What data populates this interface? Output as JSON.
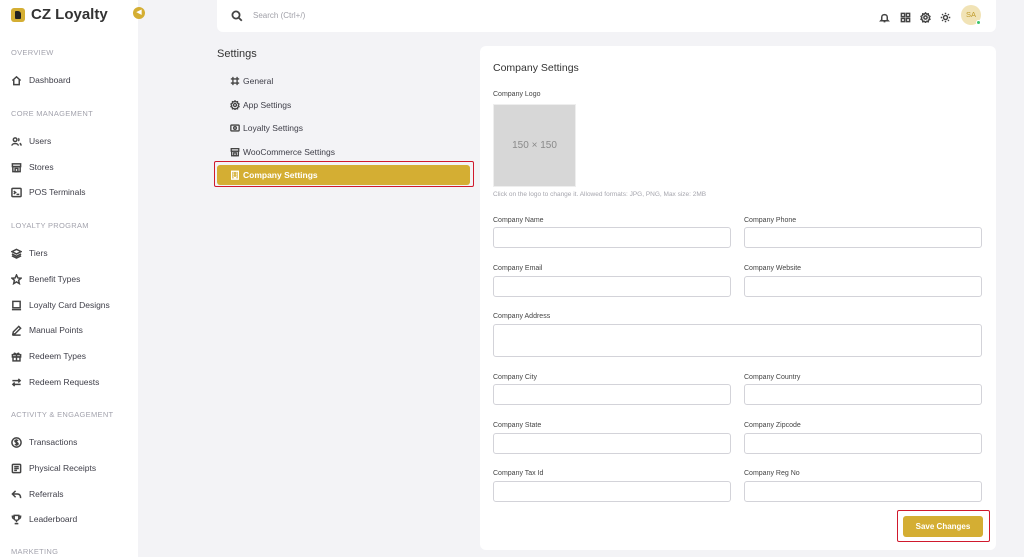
{
  "brand": {
    "name": "CZ Loyalty",
    "accent": "#d4ae33"
  },
  "sidebar": {
    "sections": [
      {
        "label": "OVERVIEW"
      },
      {
        "label": "CORE MANAGEMENT"
      },
      {
        "label": "LOYALTY PROGRAM"
      },
      {
        "label": "ACTIVITY & ENGAGEMENT"
      },
      {
        "label": "MARKETING"
      }
    ],
    "items": [
      {
        "label": "Dashboard",
        "icon": "home-icon"
      },
      {
        "label": "Users",
        "icon": "users-icon"
      },
      {
        "label": "Stores",
        "icon": "store-icon"
      },
      {
        "label": "POS Terminals",
        "icon": "terminal-icon"
      },
      {
        "label": "Tiers",
        "icon": "layers-icon"
      },
      {
        "label": "Benefit Types",
        "icon": "star-icon"
      },
      {
        "label": "Loyalty Card Designs",
        "icon": "card-icon"
      },
      {
        "label": "Manual Points",
        "icon": "pencil-icon"
      },
      {
        "label": "Redeem Types",
        "icon": "gift-icon"
      },
      {
        "label": "Redeem Requests",
        "icon": "arrows-icon"
      },
      {
        "label": "Transactions",
        "icon": "dollar-icon"
      },
      {
        "label": "Physical Receipts",
        "icon": "receipt-icon"
      },
      {
        "label": "Referrals",
        "icon": "share-icon"
      },
      {
        "label": "Leaderboard",
        "icon": "trophy-icon"
      }
    ]
  },
  "topbar": {
    "search_placeholder": "Search (Ctrl+/)",
    "avatar_initials": "SA"
  },
  "settings": {
    "title": "Settings",
    "menu": [
      {
        "label": "General",
        "icon": "frame-icon"
      },
      {
        "label": "App Settings",
        "icon": "gear-icon"
      },
      {
        "label": "Loyalty Settings",
        "icon": "ticket-icon"
      },
      {
        "label": "WooCommerce Settings",
        "icon": "shop-icon"
      },
      {
        "label": "Company Settings",
        "icon": "building-icon",
        "active": true
      }
    ]
  },
  "company": {
    "title": "Company Settings",
    "logo_label": "Company Logo",
    "logo_placeholder": "150 × 150",
    "logo_hint": "Click on the logo to change it. Allowed formats: JPG, PNG, Max size: 2MB",
    "fields": {
      "name": "Company Name",
      "phone": "Company Phone",
      "email": "Company Email",
      "website": "Company Website",
      "address": "Company Address",
      "city": "Company City",
      "country": "Company Country",
      "state": "Company State",
      "zipcode": "Company Zipcode",
      "tax_id": "Company Tax Id",
      "reg_no": "Company Reg No"
    },
    "save_label": "Save Changes"
  }
}
